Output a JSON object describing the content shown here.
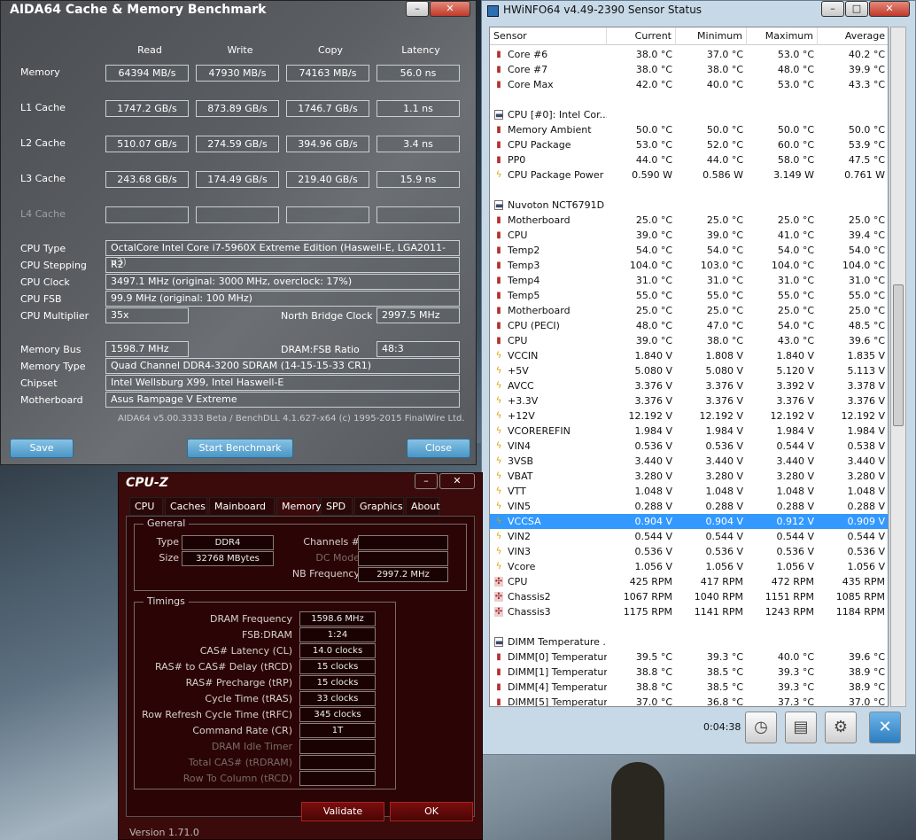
{
  "aida": {
    "title": "AIDA64 Cache & Memory Benchmark",
    "minimize": "–",
    "close": "✕",
    "headers": [
      "Read",
      "Write",
      "Copy",
      "Latency"
    ],
    "bench": [
      {
        "label": "Memory",
        "read": "64394 MB/s",
        "write": "47930 MB/s",
        "copy": "74163 MB/s",
        "latency": "56.0 ns"
      },
      {
        "label": "L1 Cache",
        "read": "1747.2 GB/s",
        "write": "873.89 GB/s",
        "copy": "1746.7 GB/s",
        "latency": "1.1 ns"
      },
      {
        "label": "L2 Cache",
        "read": "510.07 GB/s",
        "write": "274.59 GB/s",
        "copy": "394.96 GB/s",
        "latency": "3.4 ns"
      },
      {
        "label": "L3 Cache",
        "read": "243.68 GB/s",
        "write": "174.49 GB/s",
        "copy": "219.40 GB/s",
        "latency": "15.9 ns"
      },
      {
        "label": "L4 Cache",
        "read": "",
        "write": "",
        "copy": "",
        "latency": ""
      }
    ],
    "cpu_type_label": "CPU Type",
    "cpu_type": "OctalCore Intel Core i7-5960X Extreme Edition  (Haswell-E, LGA2011-v3)",
    "cpu_stepping_label": "CPU Stepping",
    "cpu_stepping": "R2",
    "cpu_clock_label": "CPU Clock",
    "cpu_clock": "3497.1 MHz  (original: 3000 MHz, overclock: 17%)",
    "cpu_fsb_label": "CPU FSB",
    "cpu_fsb": "99.9 MHz  (original: 100 MHz)",
    "cpu_mult_label": "CPU Multiplier",
    "cpu_mult": "35x",
    "nb_clock_label": "North Bridge Clock",
    "nb_clock": "2997.5 MHz",
    "mem_bus_label": "Memory Bus",
    "mem_bus": "1598.7 MHz",
    "dram_ratio_label": "DRAM:FSB Ratio",
    "dram_ratio": "48:3",
    "mem_type_label": "Memory Type",
    "mem_type": "Quad Channel DDR4-3200 SDRAM  (14-15-15-33 CR1)",
    "chipset_label": "Chipset",
    "chipset": "Intel Wellsburg X99, Intel Haswell-E",
    "mobo_label": "Motherboard",
    "mobo": "Asus Rampage V Extreme",
    "footer": "AIDA64 v5.00.3333 Beta / BenchDLL 4.1.627-x64  (c) 1995-2015 FinalWire Ltd.",
    "save": "Save",
    "start": "Start Benchmark",
    "close_btn": "Close"
  },
  "hwinfo": {
    "title": "HWiNFO64 v4.49-2390 Sensor Status",
    "min": "–",
    "max": "□",
    "close": "✕",
    "columns": [
      "Sensor",
      "Current",
      "Minimum",
      "Maximum",
      "Average"
    ],
    "rows": [
      {
        "icon": "th",
        "name": "Core #6",
        "cur": "38.0 °C",
        "min": "37.0 °C",
        "max": "53.0 °C",
        "avg": "40.2 °C"
      },
      {
        "icon": "th",
        "name": "Core #7",
        "cur": "38.0 °C",
        "min": "38.0 °C",
        "max": "48.0 °C",
        "avg": "39.9 °C"
      },
      {
        "icon": "th",
        "name": "Core Max",
        "cur": "42.0 °C",
        "min": "40.0 °C",
        "max": "53.0 °C",
        "avg": "43.3 °C"
      },
      {
        "icon": "",
        "name": "",
        "cur": "",
        "min": "",
        "max": "",
        "avg": ""
      },
      {
        "icon": "grp",
        "name": "CPU [#0]: Intel Cor...",
        "cur": "",
        "min": "",
        "max": "",
        "avg": ""
      },
      {
        "icon": "th",
        "name": "Memory Ambient",
        "cur": "50.0 °C",
        "min": "50.0 °C",
        "max": "50.0 °C",
        "avg": "50.0 °C"
      },
      {
        "icon": "th",
        "name": "CPU Package",
        "cur": "53.0 °C",
        "min": "52.0 °C",
        "max": "60.0 °C",
        "avg": "53.9 °C"
      },
      {
        "icon": "th",
        "name": "PP0",
        "cur": "44.0 °C",
        "min": "44.0 °C",
        "max": "58.0 °C",
        "avg": "47.5 °C"
      },
      {
        "icon": "vo",
        "name": "CPU Package Power",
        "cur": "0.590 W",
        "min": "0.586 W",
        "max": "3.149 W",
        "avg": "0.761 W"
      },
      {
        "icon": "",
        "name": "",
        "cur": "",
        "min": "",
        "max": "",
        "avg": ""
      },
      {
        "icon": "grp",
        "name": "Nuvoton NCT6791D",
        "cur": "",
        "min": "",
        "max": "",
        "avg": ""
      },
      {
        "icon": "th",
        "name": "Motherboard",
        "cur": "25.0 °C",
        "min": "25.0 °C",
        "max": "25.0 °C",
        "avg": "25.0 °C"
      },
      {
        "icon": "th",
        "name": "CPU",
        "cur": "39.0 °C",
        "min": "39.0 °C",
        "max": "41.0 °C",
        "avg": "39.4 °C"
      },
      {
        "icon": "th",
        "name": "Temp2",
        "cur": "54.0 °C",
        "min": "54.0 °C",
        "max": "54.0 °C",
        "avg": "54.0 °C"
      },
      {
        "icon": "th",
        "name": "Temp3",
        "cur": "104.0 °C",
        "min": "103.0 °C",
        "max": "104.0 °C",
        "avg": "104.0 °C"
      },
      {
        "icon": "th",
        "name": "Temp4",
        "cur": "31.0 °C",
        "min": "31.0 °C",
        "max": "31.0 °C",
        "avg": "31.0 °C"
      },
      {
        "icon": "th",
        "name": "Temp5",
        "cur": "55.0 °C",
        "min": "55.0 °C",
        "max": "55.0 °C",
        "avg": "55.0 °C"
      },
      {
        "icon": "th",
        "name": "Motherboard",
        "cur": "25.0 °C",
        "min": "25.0 °C",
        "max": "25.0 °C",
        "avg": "25.0 °C"
      },
      {
        "icon": "th",
        "name": "CPU (PECI)",
        "cur": "48.0 °C",
        "min": "47.0 °C",
        "max": "54.0 °C",
        "avg": "48.5 °C"
      },
      {
        "icon": "th",
        "name": "CPU",
        "cur": "39.0 °C",
        "min": "38.0 °C",
        "max": "43.0 °C",
        "avg": "39.6 °C"
      },
      {
        "icon": "vo",
        "name": "VCCIN",
        "cur": "1.840 V",
        "min": "1.808 V",
        "max": "1.840 V",
        "avg": "1.835 V"
      },
      {
        "icon": "vo",
        "name": "+5V",
        "cur": "5.080 V",
        "min": "5.080 V",
        "max": "5.120 V",
        "avg": "5.113 V"
      },
      {
        "icon": "vo",
        "name": "AVCC",
        "cur": "3.376 V",
        "min": "3.376 V",
        "max": "3.392 V",
        "avg": "3.378 V"
      },
      {
        "icon": "vo",
        "name": "+3.3V",
        "cur": "3.376 V",
        "min": "3.376 V",
        "max": "3.376 V",
        "avg": "3.376 V"
      },
      {
        "icon": "vo",
        "name": "+12V",
        "cur": "12.192 V",
        "min": "12.192 V",
        "max": "12.192 V",
        "avg": "12.192 V"
      },
      {
        "icon": "vo",
        "name": "VCOREREFIN",
        "cur": "1.984 V",
        "min": "1.984 V",
        "max": "1.984 V",
        "avg": "1.984 V"
      },
      {
        "icon": "vo",
        "name": "VIN4",
        "cur": "0.536 V",
        "min": "0.536 V",
        "max": "0.544 V",
        "avg": "0.538 V"
      },
      {
        "icon": "vo",
        "name": "3VSB",
        "cur": "3.440 V",
        "min": "3.440 V",
        "max": "3.440 V",
        "avg": "3.440 V"
      },
      {
        "icon": "vo",
        "name": "VBAT",
        "cur": "3.280 V",
        "min": "3.280 V",
        "max": "3.280 V",
        "avg": "3.280 V"
      },
      {
        "icon": "vo",
        "name": "VTT",
        "cur": "1.048 V",
        "min": "1.048 V",
        "max": "1.048 V",
        "avg": "1.048 V"
      },
      {
        "icon": "vo",
        "name": "VIN5",
        "cur": "0.288 V",
        "min": "0.288 V",
        "max": "0.288 V",
        "avg": "0.288 V"
      },
      {
        "icon": "vo",
        "name": "VCCSA",
        "cur": "0.904 V",
        "min": "0.904 V",
        "max": "0.912 V",
        "avg": "0.909 V",
        "selected": true
      },
      {
        "icon": "vo",
        "name": "VIN2",
        "cur": "0.544 V",
        "min": "0.544 V",
        "max": "0.544 V",
        "avg": "0.544 V"
      },
      {
        "icon": "vo",
        "name": "VIN3",
        "cur": "0.536 V",
        "min": "0.536 V",
        "max": "0.536 V",
        "avg": "0.536 V"
      },
      {
        "icon": "vo",
        "name": "Vcore",
        "cur": "1.056 V",
        "min": "1.056 V",
        "max": "1.056 V",
        "avg": "1.056 V"
      },
      {
        "icon": "fa",
        "name": "CPU",
        "cur": "425 RPM",
        "min": "417 RPM",
        "max": "472 RPM",
        "avg": "435 RPM"
      },
      {
        "icon": "fa",
        "name": "Chassis2",
        "cur": "1067 RPM",
        "min": "1040 RPM",
        "max": "1151 RPM",
        "avg": "1085 RPM"
      },
      {
        "icon": "fa",
        "name": "Chassis3",
        "cur": "1175 RPM",
        "min": "1141 RPM",
        "max": "1243 RPM",
        "avg": "1184 RPM"
      },
      {
        "icon": "",
        "name": "",
        "cur": "",
        "min": "",
        "max": "",
        "avg": ""
      },
      {
        "icon": "grp",
        "name": "DIMM Temperature ...",
        "cur": "",
        "min": "",
        "max": "",
        "avg": ""
      },
      {
        "icon": "th",
        "name": "DIMM[0] Temperature",
        "cur": "39.5 °C",
        "min": "39.3 °C",
        "max": "40.0 °C",
        "avg": "39.6 °C"
      },
      {
        "icon": "th",
        "name": "DIMM[1] Temperature",
        "cur": "38.8 °C",
        "min": "38.5 °C",
        "max": "39.3 °C",
        "avg": "38.9 °C"
      },
      {
        "icon": "th",
        "name": "DIMM[4] Temperature",
        "cur": "38.8 °C",
        "min": "38.5 °C",
        "max": "39.3 °C",
        "avg": "38.9 °C"
      },
      {
        "icon": "th",
        "name": "DIMM[5] Temperature",
        "cur": "37.0 °C",
        "min": "36.8 °C",
        "max": "37.3 °C",
        "avg": "37.0 °C"
      }
    ],
    "timer": "0:04:38"
  },
  "cpuz": {
    "title": "CPU-Z",
    "min": "–",
    "close": "✕",
    "tabs": [
      "CPU",
      "Caches",
      "Mainboard",
      "Memory",
      "SPD",
      "Graphics",
      "About"
    ],
    "active_tab": "Memory",
    "general_title": "General",
    "type_label": "Type",
    "type": "DDR4",
    "size_label": "Size",
    "size": "32768 MBytes",
    "channels_label": "Channels #",
    "channels": "",
    "dcmode_label": "DC Mode",
    "dcmode": "",
    "nbfreq_label": "NB Frequency",
    "nbfreq": "2997.2 MHz",
    "timings_title": "Timings",
    "timings": [
      {
        "label": "DRAM Frequency",
        "value": "1598.6 MHz",
        "dim": false
      },
      {
        "label": "FSB:DRAM",
        "value": "1:24",
        "dim": false
      },
      {
        "label": "CAS# Latency (CL)",
        "value": "14.0 clocks",
        "dim": false
      },
      {
        "label": "RAS# to CAS# Delay (tRCD)",
        "value": "15 clocks",
        "dim": false
      },
      {
        "label": "RAS# Precharge (tRP)",
        "value": "15 clocks",
        "dim": false
      },
      {
        "label": "Cycle Time (tRAS)",
        "value": "33 clocks",
        "dim": false
      },
      {
        "label": "Row Refresh Cycle Time (tRFC)",
        "value": "345 clocks",
        "dim": false
      },
      {
        "label": "Command Rate (CR)",
        "value": "1T",
        "dim": false
      },
      {
        "label": "DRAM Idle Timer",
        "value": "",
        "dim": true
      },
      {
        "label": "Total CAS# (tRDRAM)",
        "value": "",
        "dim": true
      },
      {
        "label": "Row To Column (tRCD)",
        "value": "",
        "dim": true
      }
    ],
    "validate": "Validate",
    "ok": "OK",
    "version": "Version 1.71.0"
  }
}
